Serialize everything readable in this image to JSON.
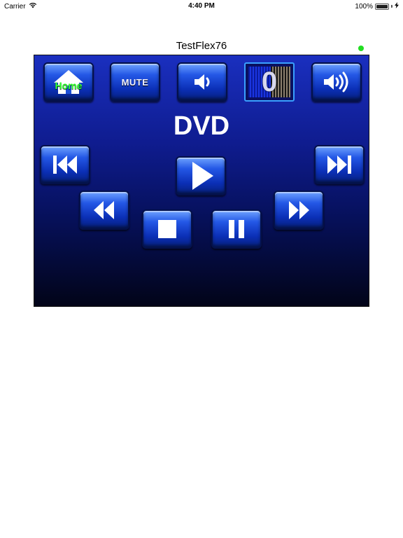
{
  "status_bar": {
    "carrier": "Carrier",
    "time": "4:40 PM",
    "battery_percent": "100%",
    "battery_level": 1.0
  },
  "title": "TestFlex76",
  "connection_status_color": "#22dd22",
  "remote": {
    "home_label": "Home",
    "mute_label": "MUTE",
    "volume_level": "0",
    "source_label": "DVD",
    "buttons": {
      "volume_down": "speaker-low-icon",
      "volume_up": "speaker-high-icon",
      "prev": "skip-previous-icon",
      "next": "skip-next-icon",
      "play": "play-icon",
      "rewind": "rewind-icon",
      "fast_forward": "fast-forward-icon",
      "stop": "stop-icon",
      "pause": "pause-icon"
    }
  }
}
